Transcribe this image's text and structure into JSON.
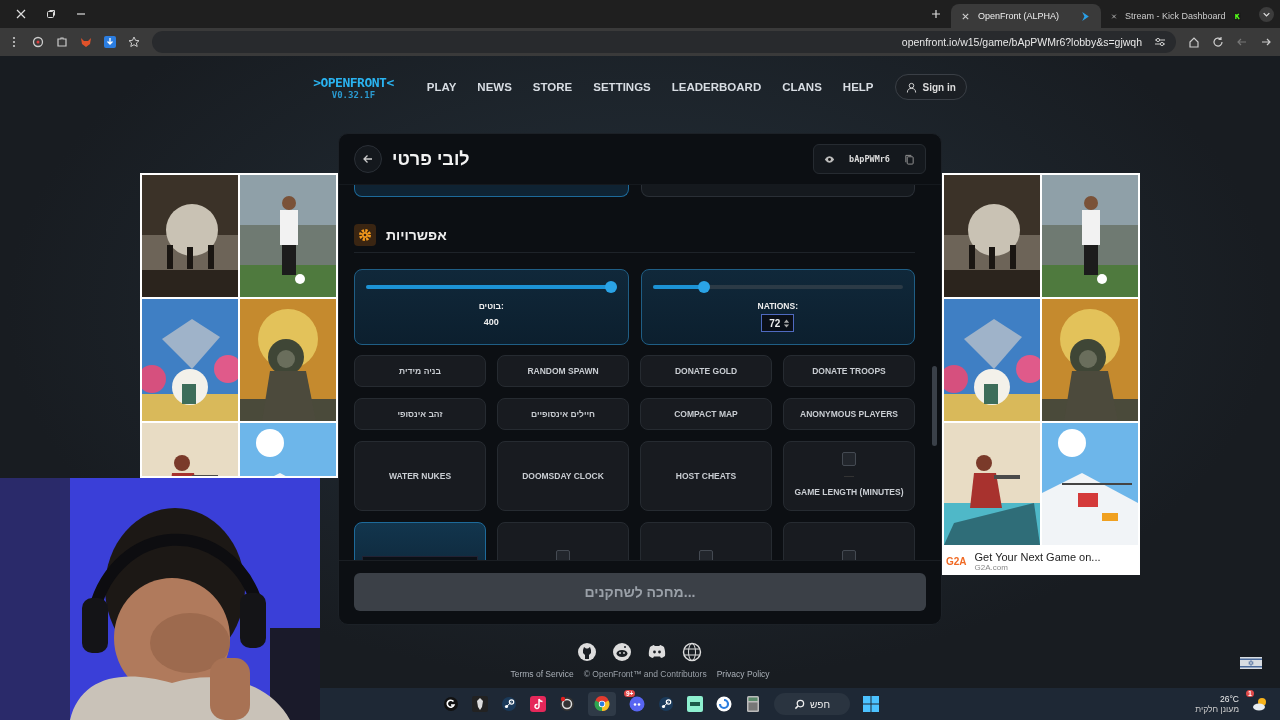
{
  "browser": {
    "tabs": [
      {
        "title": "OpenFront (ALPHA)",
        "selected": true
      },
      {
        "title": "Stream - Kick Dashboard",
        "selected": false
      }
    ],
    "url": "openfront.io/w15/game/bApPWMr6?lobby&s=gjwqh"
  },
  "nav": {
    "logo": ">OPENFRONT<",
    "version": "V0.32.1F",
    "items": [
      "PLAY",
      "NEWS",
      "STORE",
      "SETTINGS",
      "LEADERBOARD",
      "CLANS",
      "HELP"
    ],
    "sign_in": "Sign in"
  },
  "ads": [
    {
      "kind": "tiles"
    },
    {
      "kind": "tiles_caption",
      "logo": "G2A",
      "caption": "Get Your Next Game on...",
      "source": "G2A.com"
    }
  ],
  "lobby": {
    "title": "לובי פרטי",
    "code": "bApPWMr6",
    "section": "אפשרויות",
    "sliders": [
      {
        "kind": "readout",
        "label": "בוטים:",
        "value": "400",
        "level": 1
      },
      {
        "kind": "input",
        "label": "NATIONS:",
        "value": "72",
        "level": 0.19
      }
    ],
    "options": [
      {
        "kind": "toggle",
        "label": "בניה מידית",
        "selected": false
      },
      {
        "kind": "toggle",
        "label": "RANDOM SPAWN",
        "selected": false
      },
      {
        "kind": "toggle",
        "label": "DONATE GOLD",
        "selected": false
      },
      {
        "kind": "toggle",
        "label": "DONATE TROOPS",
        "selected": false
      },
      {
        "kind": "toggle",
        "label": "זהב אינסופי",
        "selected": false
      },
      {
        "kind": "toggle",
        "label": "חיילים אינסופיים",
        "selected": false
      },
      {
        "kind": "toggle",
        "label": "COMPACT MAP",
        "selected": false
      },
      {
        "kind": "toggle",
        "label": "ANONYMOUS PLAYERS",
        "selected": false
      },
      {
        "kind": "toggle",
        "label": "WATER NUKES",
        "selected": false
      },
      {
        "kind": "toggle",
        "label": "DOOMSDAY CLOCK",
        "selected": false
      },
      {
        "kind": "toggle",
        "label": "HOST CHEATS",
        "selected": false
      },
      {
        "kind": "checkbox",
        "label": "GAME LENGTH (MINUTES)",
        "checked": false,
        "selected": false
      },
      {
        "kind": "input",
        "selected": true
      },
      {
        "kind": "checkbox",
        "checked": false,
        "selected": false
      },
      {
        "kind": "checkbox",
        "checked": false,
        "selected": false
      },
      {
        "kind": "checkbox",
        "checked": false,
        "selected": false
      }
    ],
    "start_button": {
      "label": "מחכה לשחקנים...",
      "disabled": true
    }
  },
  "footer": {
    "links": [
      {
        "kind": "link",
        "text": "Terms of Service"
      },
      {
        "kind": "text",
        "text": "© OpenFront™ and Contributors"
      },
      {
        "kind": "link",
        "text": "Privacy Policy"
      }
    ]
  },
  "taskbar": {
    "badge": "9+",
    "search": "חפש",
    "temperature": "26°C",
    "weather": "מעונן חלקית",
    "weather_badge": "1"
  }
}
